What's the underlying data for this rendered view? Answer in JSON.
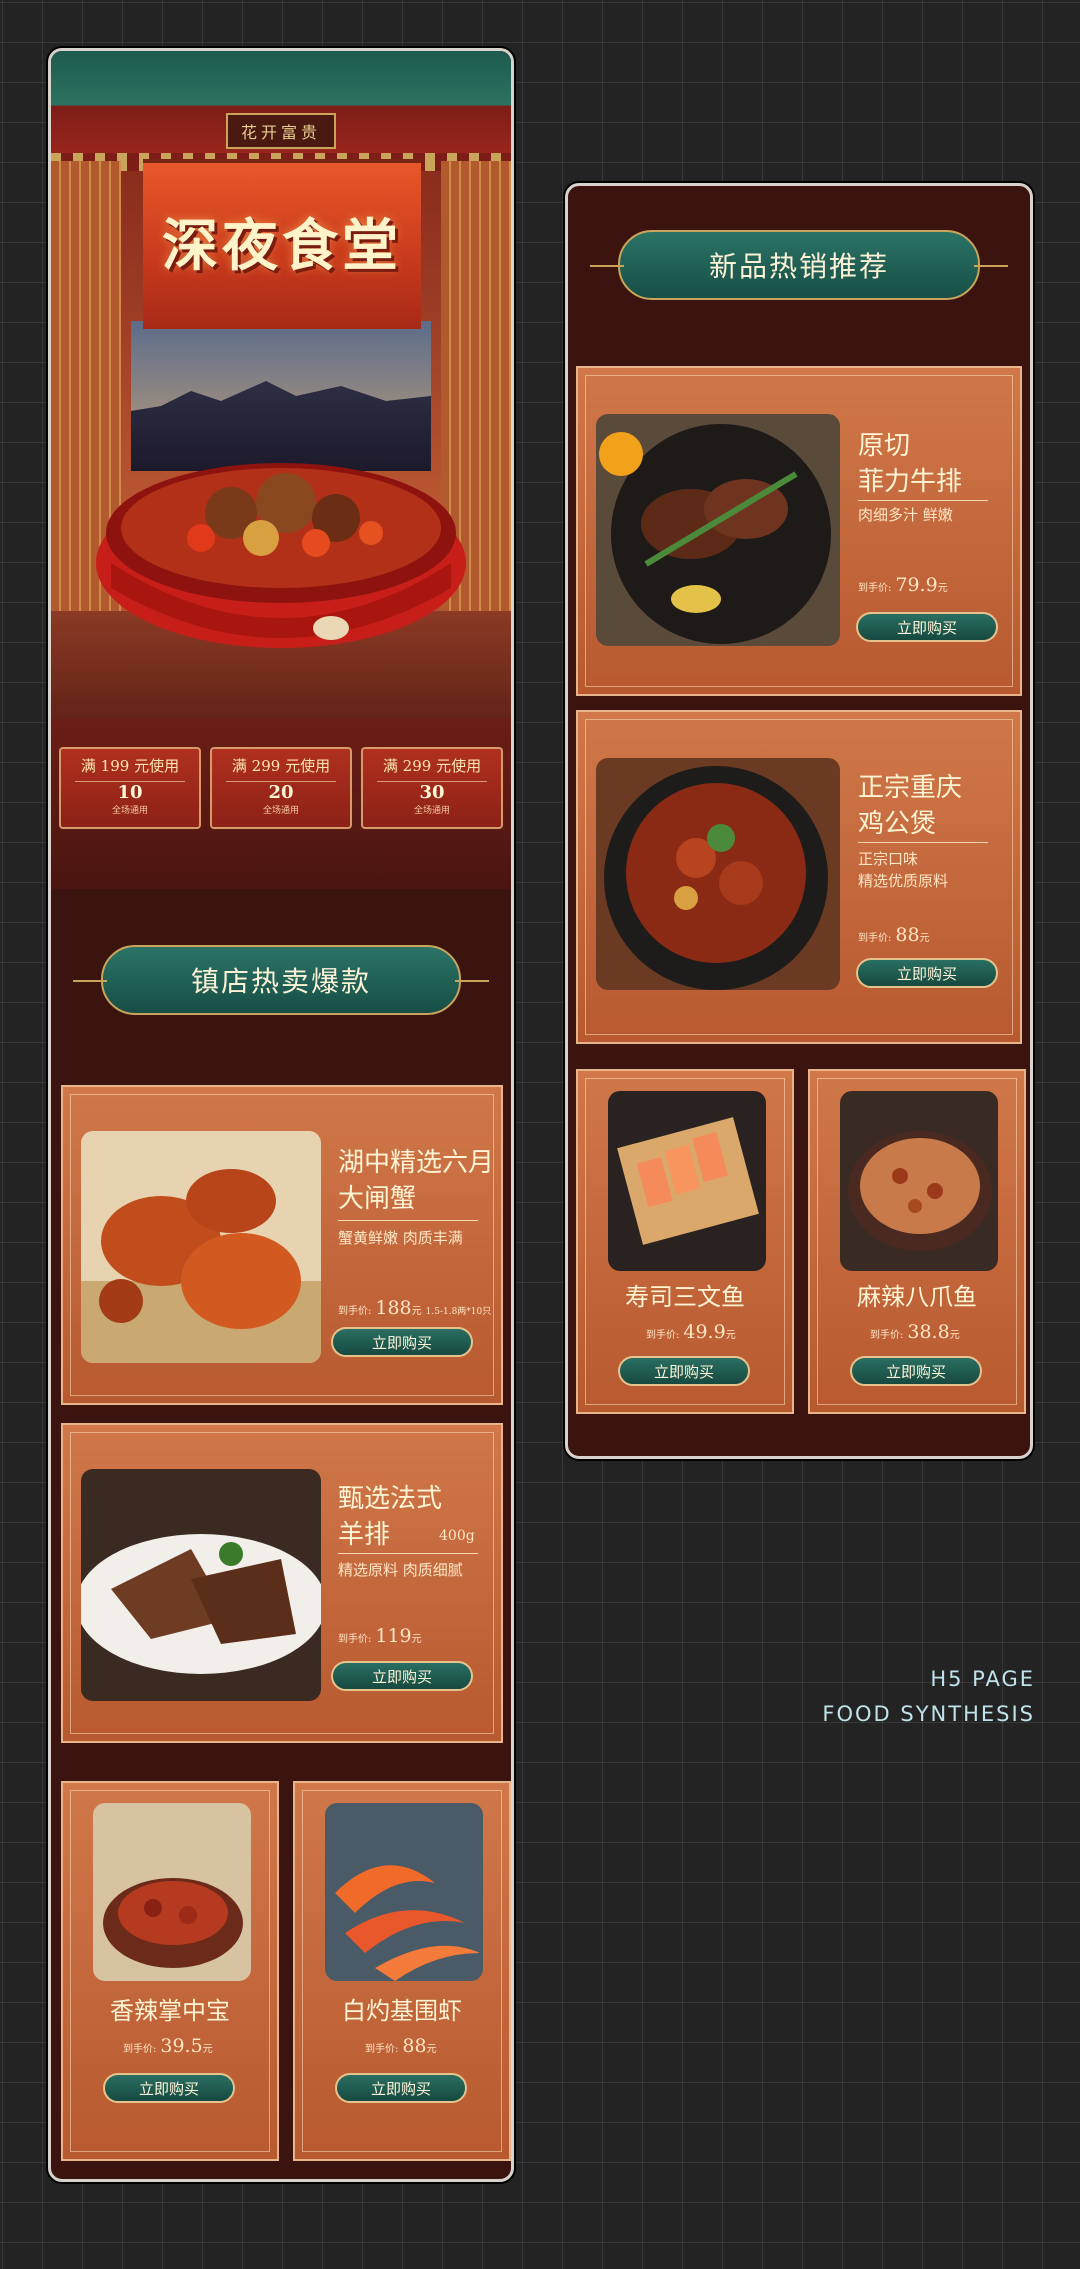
{
  "hero": {
    "plaque": "花开富贵",
    "title": "深夜食堂",
    "coupons": [
      {
        "cond": "满 199 元使用",
        "value": "10",
        "note": "全场通用"
      },
      {
        "cond": "满 299 元使用",
        "value": "20",
        "note": "全场通用"
      },
      {
        "cond": "满 299 元使用",
        "value": "30",
        "note": "全场通用"
      }
    ]
  },
  "left": {
    "section_title": "镇店热卖爆款",
    "featured": [
      {
        "name": "湖中精选六月\n大闸蟹",
        "desc": "蟹黄鲜嫩 肉质丰满",
        "price_label": "到手价:",
        "price": "188",
        "unit": "元",
        "extra": "1.5-1.8两*10只",
        "buy": "立即购买"
      },
      {
        "name": "甄选法式\n羊排",
        "weight": "400g",
        "desc": "精选原料 肉质细腻",
        "price_label": "到手价:",
        "price": "119",
        "unit": "元",
        "buy": "立即购买"
      }
    ],
    "small": [
      {
        "name": "香辣掌中宝",
        "price_label": "到手价:",
        "price": "39.5",
        "unit": "元",
        "buy": "立即购买"
      },
      {
        "name": "白灼基围虾",
        "price_label": "到手价:",
        "price": "88",
        "unit": "元",
        "buy": "立即购买"
      }
    ]
  },
  "right": {
    "section_title": "新品热销推荐",
    "featured": [
      {
        "name": "原切\n菲力牛排",
        "desc": "肉细多汁 鲜嫩",
        "price_label": "到手价:",
        "price": "79.9",
        "unit": "元",
        "buy": "立即购买"
      },
      {
        "name": "正宗重庆\n鸡公煲",
        "desc": "正宗口味\n精选优质原料",
        "price_label": "到手价:",
        "price": "88",
        "unit": "元",
        "buy": "立即购买"
      }
    ],
    "small": [
      {
        "name": "寿司三文鱼",
        "price_label": "到手价:",
        "price": "49.9",
        "unit": "元",
        "buy": "立即购买"
      },
      {
        "name": "麻辣八爪鱼",
        "price_label": "到手价:",
        "price": "38.8",
        "unit": "元",
        "buy": "立即购买"
      }
    ]
  },
  "watermark": {
    "line1": "H5 PAGE",
    "line2": "FOOD SYNTHESIS"
  },
  "colors": {
    "accent_green": "#1f5f54",
    "card_orange": "#c4653a",
    "frame_brown": "#3b1410",
    "gold": "#c9a45a"
  }
}
